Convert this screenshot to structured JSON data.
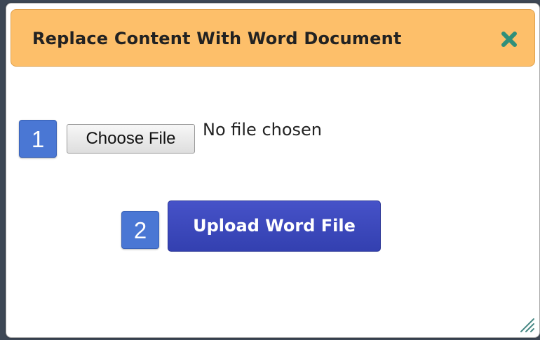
{
  "dialog": {
    "title": "Replace Content With Word Document",
    "close_icon": "close-x-icon",
    "colors": {
      "titlebar": "#fdbf6a",
      "close_icon": "#2f8f7a",
      "step_badge": "#4a77d4",
      "upload_button": "#3a46bd"
    }
  },
  "steps": [
    {
      "number": "1"
    },
    {
      "number": "2"
    }
  ],
  "file_input": {
    "button_label": "Choose File",
    "status": "No file chosen"
  },
  "upload": {
    "button_label": "Upload Word File"
  },
  "resize_icon": "resize-grip-icon"
}
